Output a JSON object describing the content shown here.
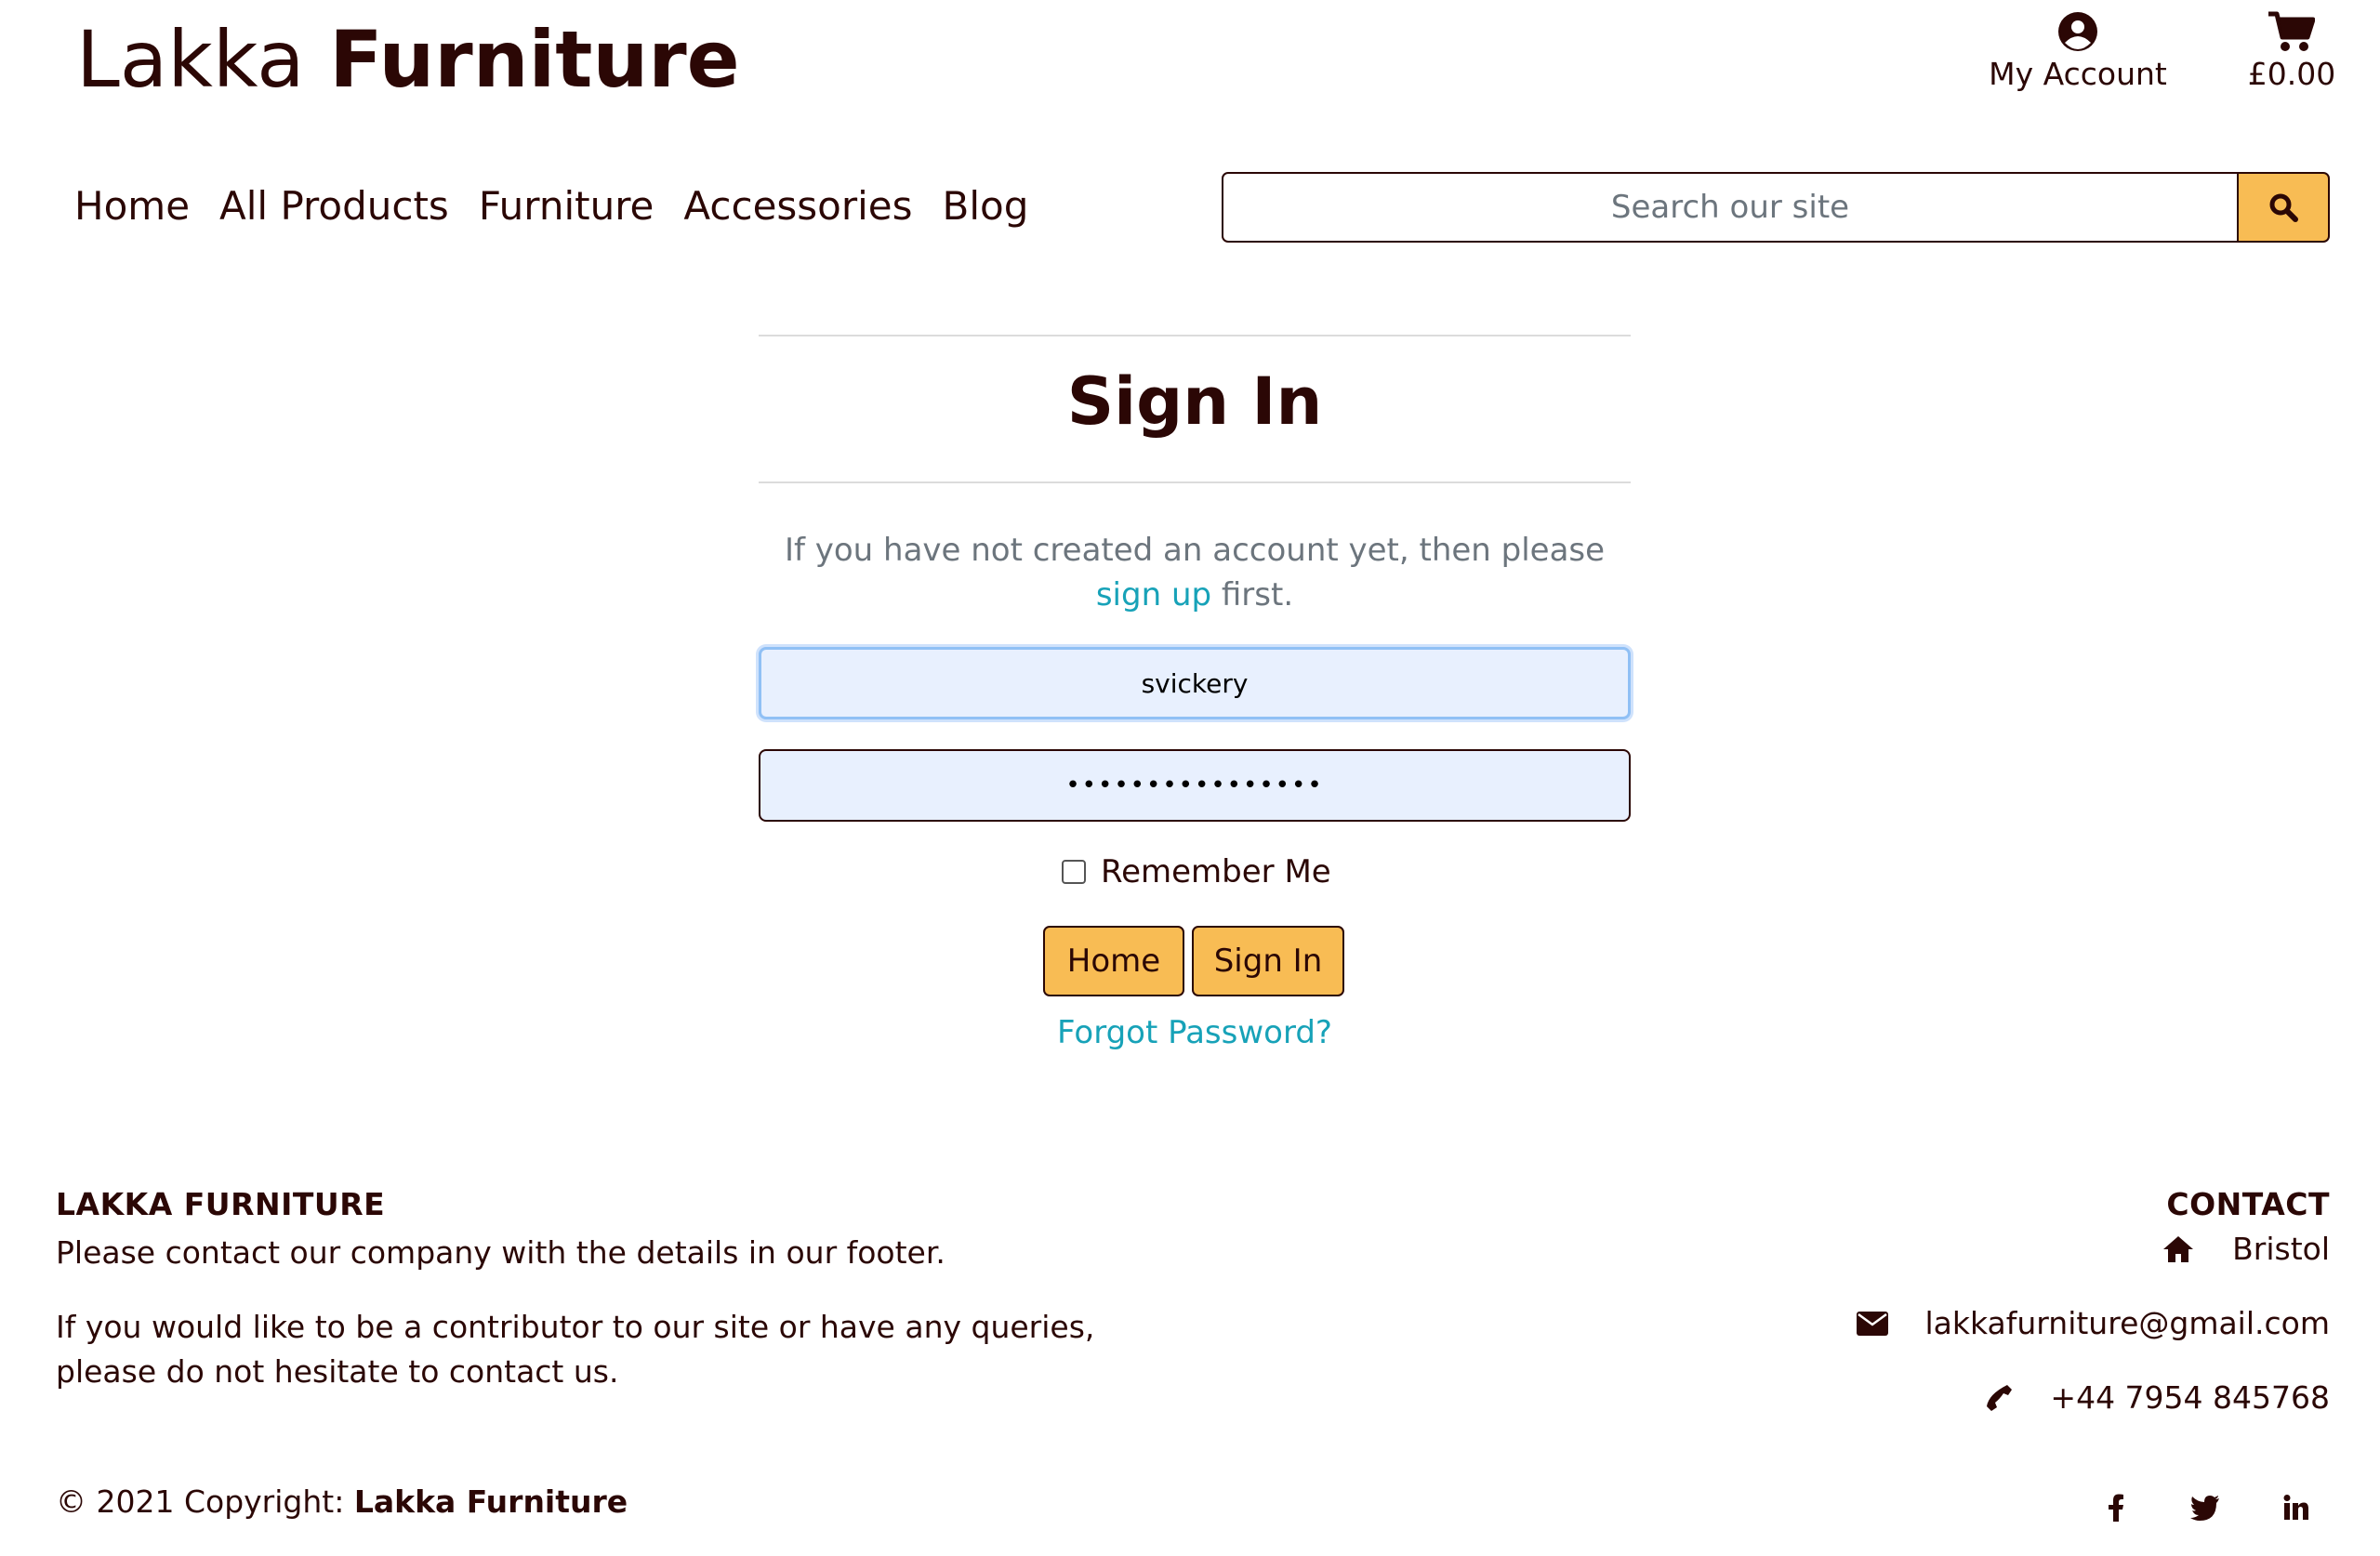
{
  "header": {
    "brand_part1": "Lakka",
    "brand_part2": "Furniture",
    "account_label": "My Account",
    "cart_total": "£0.00"
  },
  "nav": {
    "items": [
      "Home",
      "All Products",
      "Furniture",
      "Accessories",
      "Blog"
    ]
  },
  "search": {
    "placeholder": "Search our site"
  },
  "signin": {
    "title": "Sign In",
    "intro_before": "If you have not created an account yet, then please ",
    "intro_link": "sign up",
    "intro_after": " first.",
    "username_value": "svickery",
    "password_value": "••••••••••••••••",
    "remember_label": "Remember Me",
    "home_button": "Home",
    "signin_button": "Sign In",
    "forgot_link": "Forgot Password?"
  },
  "footer": {
    "left_heading": "LAKKA FURNITURE",
    "left_text1": "Please contact our company with the details in our footer.",
    "left_text2": "If you would like to be a contributor to our site or have any queries, please do not hesitate to contact us.",
    "right_heading": "CONTACT",
    "location": "Bristol",
    "email": "lakkafurniture@gmail.com",
    "phone": "+44 7954 845768",
    "copyright_prefix": "© 2021 Copyright: ",
    "copyright_brand": "Lakka Furniture"
  },
  "colors": {
    "brand_text": "#2b0705",
    "accent_button": "#f8bc54",
    "link": "#17a2b8",
    "autofill_bg": "#e8f0fe"
  },
  "icons": [
    "user-circle-icon",
    "shopping-cart-icon",
    "search-icon",
    "home-icon",
    "envelope-icon",
    "phone-icon",
    "facebook-icon",
    "twitter-icon",
    "linkedin-icon"
  ]
}
